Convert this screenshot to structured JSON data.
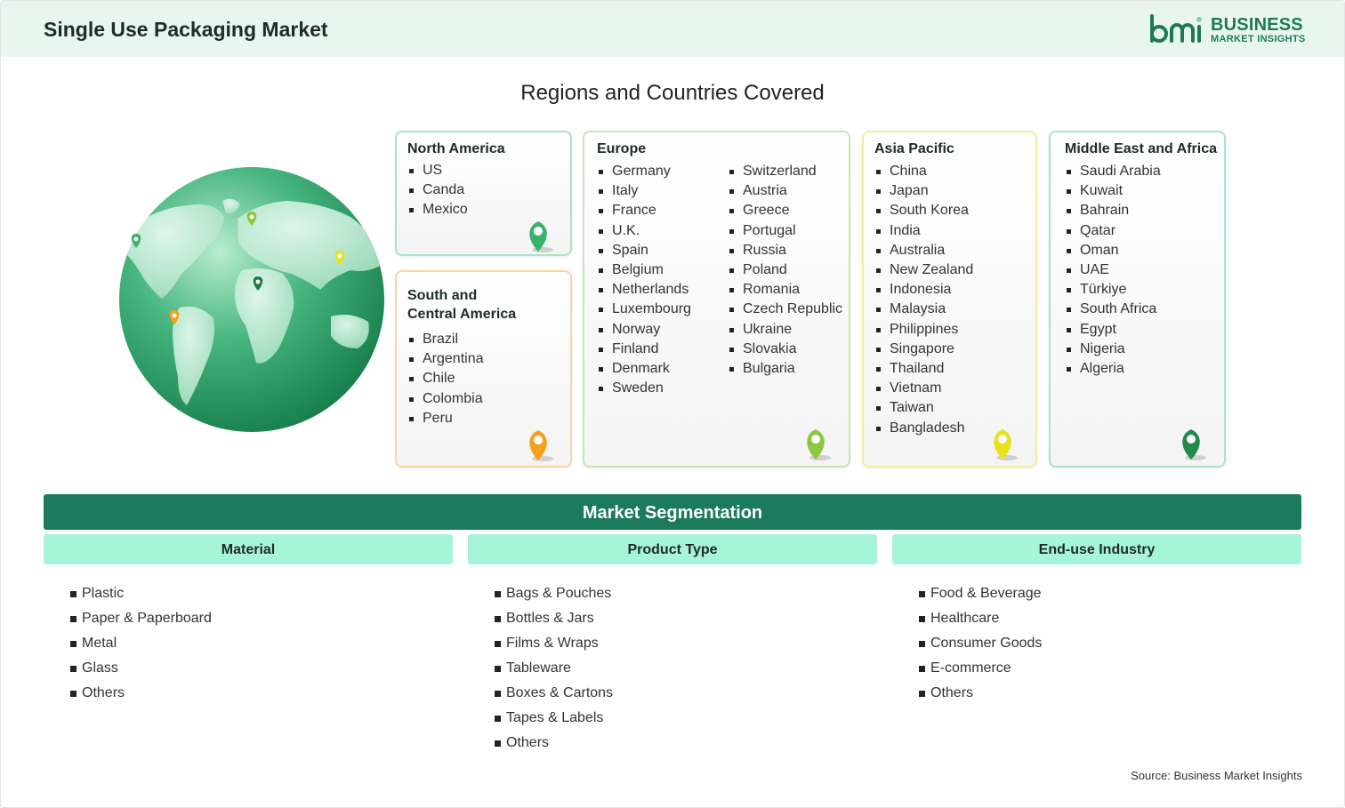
{
  "header": {
    "title": "Single Use Packaging Market"
  },
  "logo": {
    "line1": "BUSINESS",
    "line2": "MARKET INSIGHTS"
  },
  "regions": {
    "title": "Regions and Countries Covered",
    "north_america": {
      "title": "North America",
      "items": [
        "US",
        "Canda",
        "Mexico"
      ],
      "pin_color": "#3bb26b"
    },
    "south_central_america": {
      "title_line1": "South and",
      "title_line2": "Central America",
      "items": [
        "Brazil",
        "Argentina",
        "Chile",
        "Colombia",
        "Peru"
      ],
      "pin_color": "#f5a21a"
    },
    "europe": {
      "title": "Europe",
      "col1": [
        "Germany",
        "Italy",
        "France",
        "U.K.",
        "Spain",
        "Belgium",
        "Netherlands",
        "Luxembourg",
        "Norway",
        "Finland",
        "Denmark",
        "Sweden"
      ],
      "col2": [
        "Switzerland",
        "Austria",
        "Greece",
        "Portugal",
        "Russia",
        "Poland",
        "Romania",
        "Czech Republic",
        "Ukraine",
        "Slovakia",
        "Bulgaria"
      ],
      "pin_color": "#8dc63f"
    },
    "asia_pacific": {
      "title": "Asia Pacific",
      "items": [
        "China",
        "Japan",
        "South Korea",
        "India",
        "Australia",
        "New Zealand",
        "Indonesia",
        "Malaysia",
        "Philippines",
        "Singapore",
        "Thailand",
        "Vietnam",
        "Taiwan",
        "Bangladesh"
      ],
      "pin_color": "#e8e21d"
    },
    "mea": {
      "title": "Middle East and Africa",
      "items": [
        "Saudi Arabia",
        "Kuwait",
        "Bahrain",
        "Qatar",
        "Oman",
        "UAE",
        "Türkiye",
        "South Africa",
        "Egypt",
        "Nigeria",
        "Algeria"
      ],
      "pin_color": "#1f8a4a"
    }
  },
  "segmentation": {
    "title": "Market Segmentation",
    "material": {
      "title": "Material",
      "items": [
        "Plastic",
        "Paper & Paperboard",
        "Metal",
        "Glass",
        "Others"
      ]
    },
    "product_type": {
      "title": "Product Type",
      "items": [
        "Bags & Pouches",
        "Bottles & Jars",
        "Films & Wraps",
        "Tableware",
        "Boxes & Cartons",
        "Tapes & Labels",
        "Others"
      ]
    },
    "end_use": {
      "title": "End-use Industry",
      "items": [
        "Food & Beverage",
        "Healthcare",
        "Consumer Goods",
        "E-commerce",
        "Others"
      ]
    }
  },
  "source": "Source: Business Market Insights",
  "colors": {
    "header_bg": "#e9f6ef",
    "seg_bar": "#1c7a5c",
    "seg_head": "#a7f5d9",
    "brand": "#1e7a55"
  }
}
